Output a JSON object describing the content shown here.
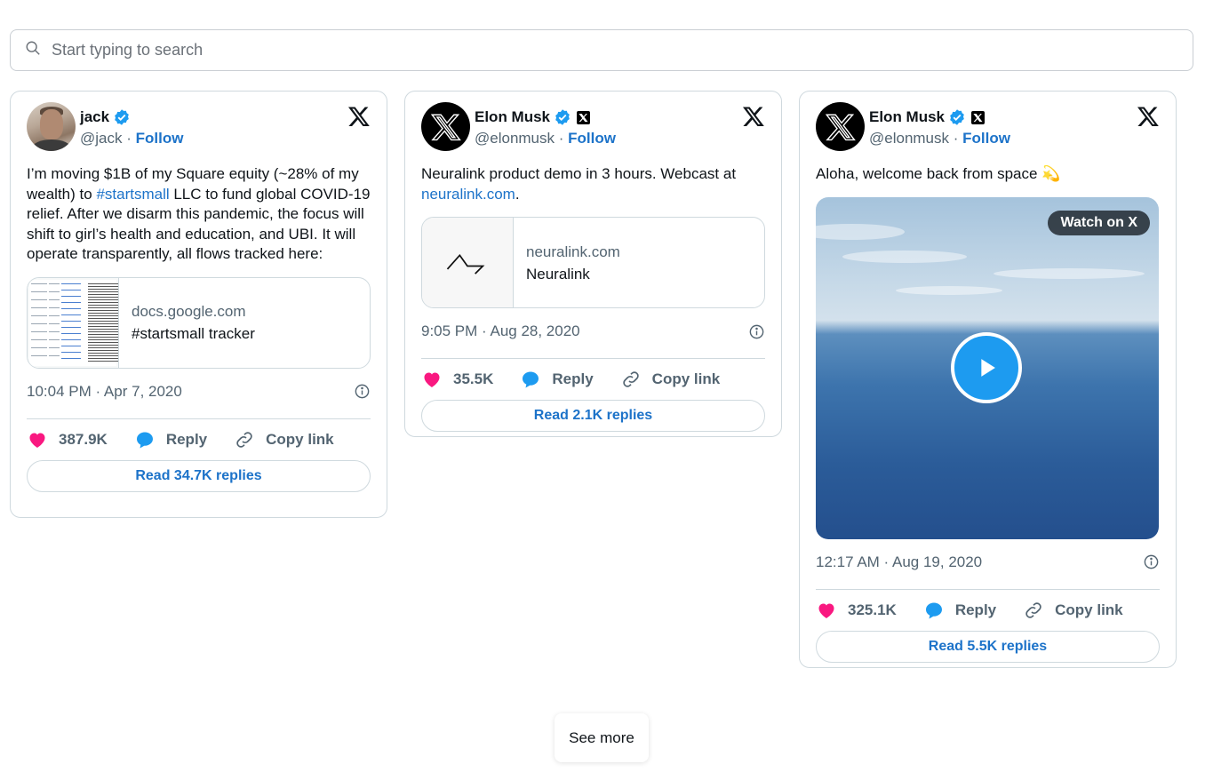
{
  "search": {
    "placeholder": "Start typing to search"
  },
  "tweets": [
    {
      "name": "jack",
      "handle": "@jack",
      "separator": "·",
      "follow_label": "Follow",
      "text_parts": [
        "I’m moving $1B of my Square equity (~28% of my wealth) to ",
        "#startsmall",
        " LLC to fund global COVID-19 relief. After we disarm this pandemic, the focus will shift to girl’s health and education, and UBI. It will operate transparently, all flows tracked here:"
      ],
      "link_card": {
        "domain": "docs.google.com",
        "title": "#startsmall tracker"
      },
      "timestamp": "10:04 PM · Apr 7, 2020",
      "likes": "387.9K",
      "reply_label": "Reply",
      "copy_label": "Copy link",
      "read_replies_label": "Read 34.7K replies"
    },
    {
      "name": "Elon Musk",
      "handle": "@elonmusk",
      "separator": "·",
      "follow_label": "Follow",
      "text_parts": [
        "Neuralink product demo in 3 hours. Webcast at ",
        "neuralink.com",
        "."
      ],
      "link_card": {
        "domain": "neuralink.com",
        "title": "Neuralink"
      },
      "timestamp": "9:05 PM · Aug 28, 2020",
      "likes": "35.5K",
      "reply_label": "Reply",
      "copy_label": "Copy link",
      "read_replies_label": "Read 2.1K replies"
    },
    {
      "name": "Elon Musk",
      "handle": "@elonmusk",
      "separator": "·",
      "follow_label": "Follow",
      "text": "Aloha, welcome back from space 💫",
      "media": {
        "watch_label": "Watch on X"
      },
      "timestamp": "12:17 AM · Aug 19, 2020",
      "likes": "325.1K",
      "reply_label": "Reply",
      "copy_label": "Copy link",
      "read_replies_label": "Read 5.5K replies"
    }
  ],
  "see_more_label": "See more",
  "colors": {
    "link": "#1d73c9",
    "heart": "#f91880",
    "reply": "#1d9bf0",
    "verified": "#1d9bf0",
    "muted": "#536471"
  },
  "icons": [
    "search-icon",
    "verified-badge-icon",
    "x-logo-icon",
    "info-icon",
    "heart-icon",
    "reply-bubble-icon",
    "link-icon",
    "play-icon",
    "neuralink-logo-icon"
  ]
}
